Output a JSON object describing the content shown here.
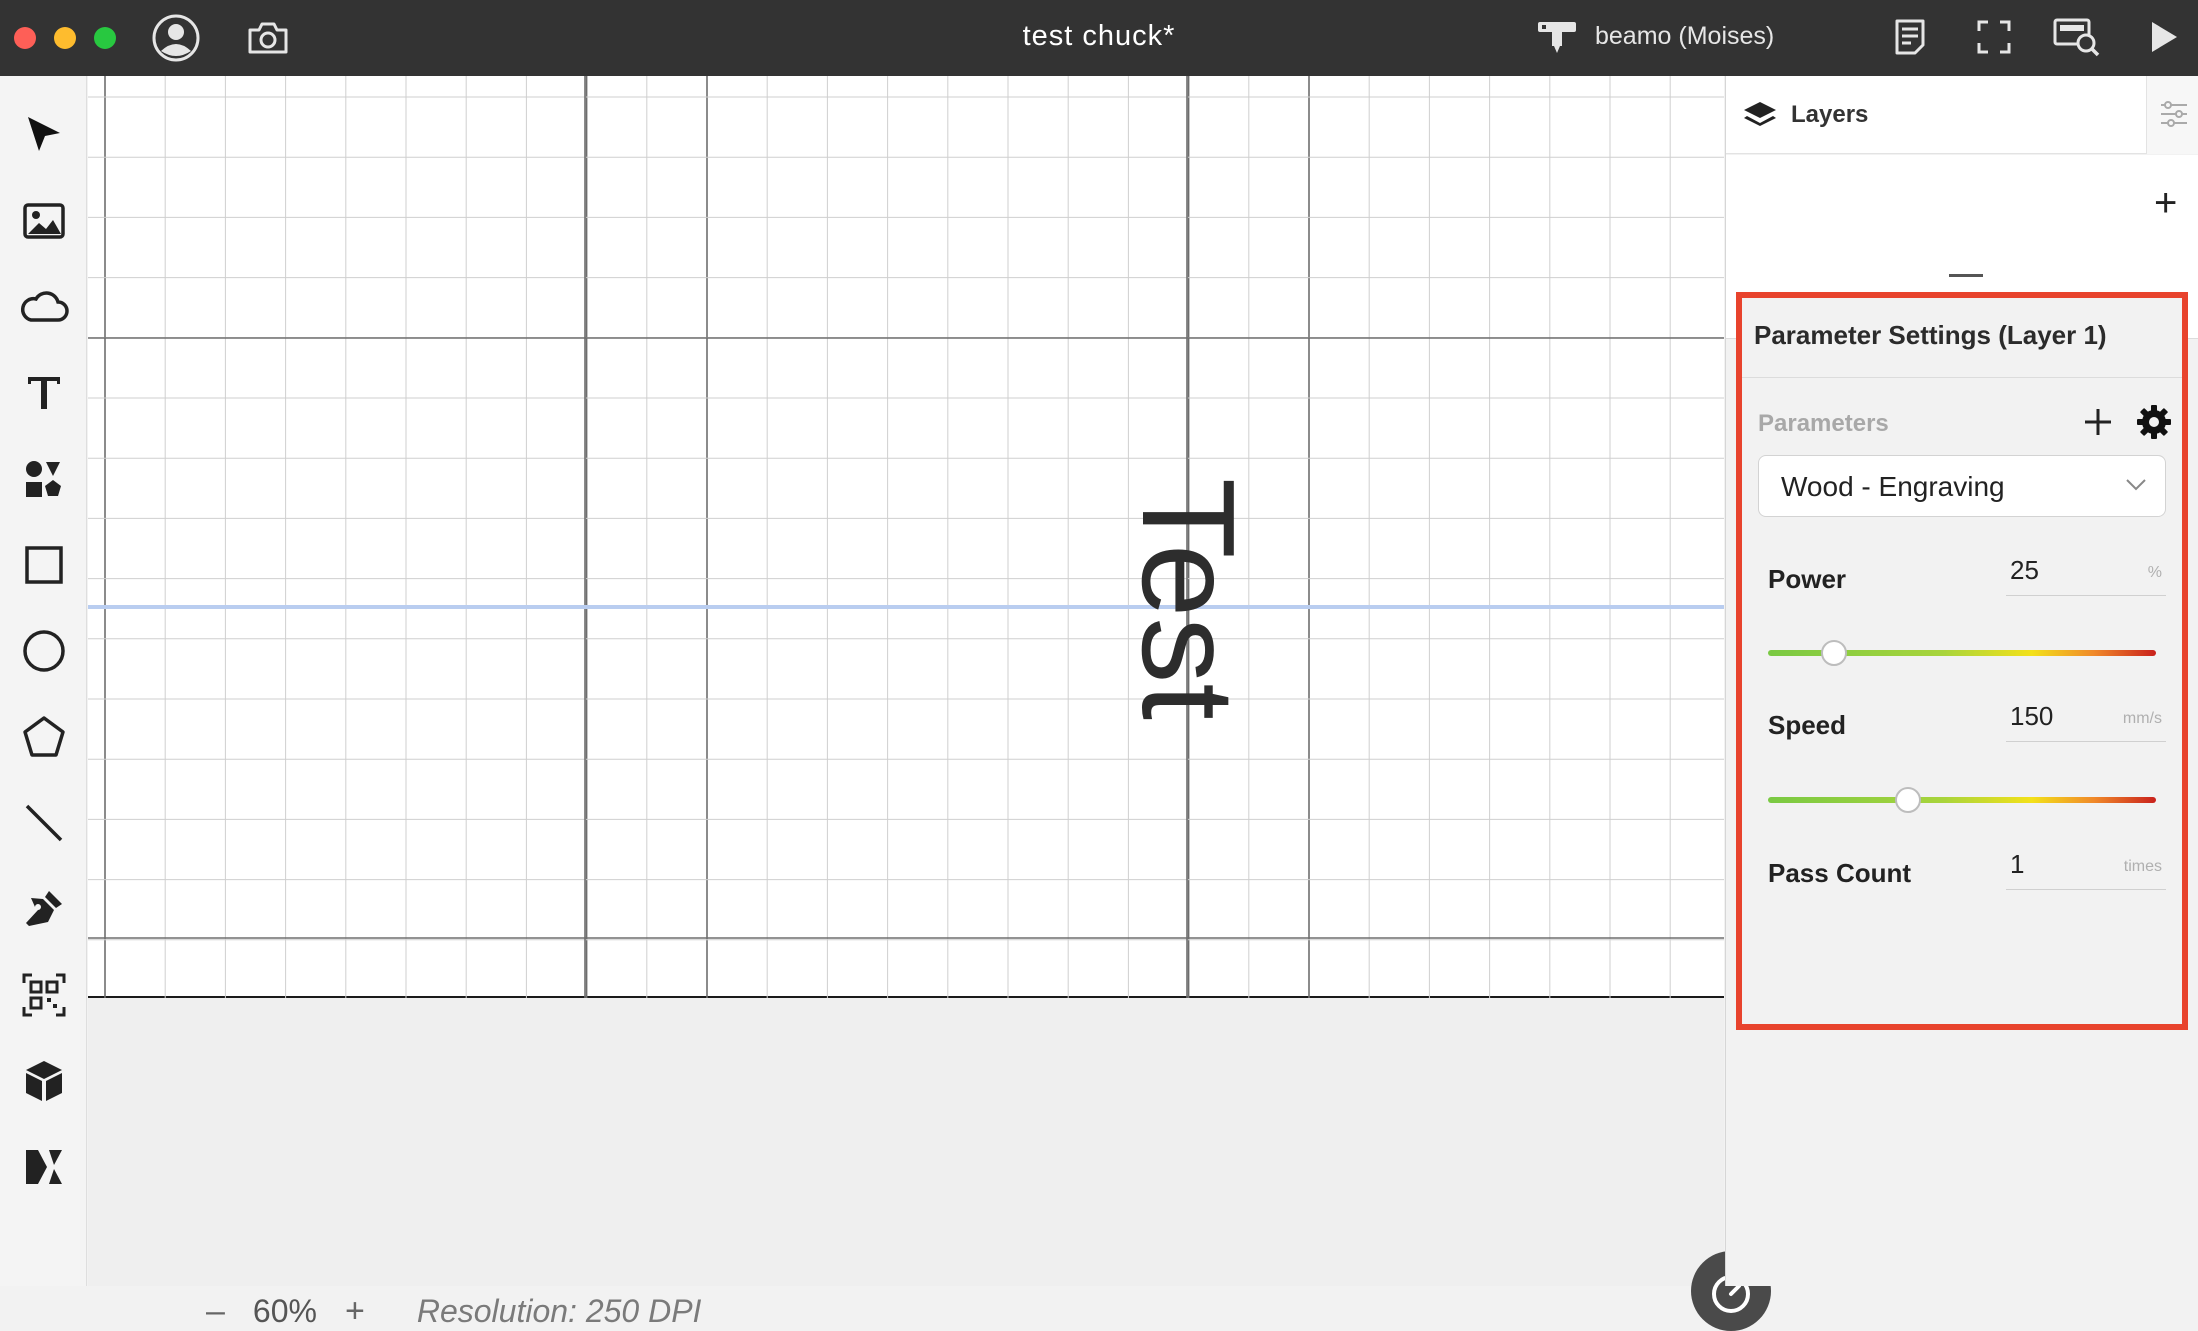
{
  "window": {
    "title": "test chuck*",
    "device_name": "beamo (Moises)"
  },
  "colors": {
    "titlebar": "#333333",
    "close": "#fe5f57",
    "minimize": "#febc2e",
    "maximize": "#28c840",
    "highlight_border": "#e8432d"
  },
  "left_toolbar": {
    "tools": [
      "cursor-icon",
      "image-icon",
      "cloud-icon",
      "text-icon",
      "elements-icon",
      "rectangle-icon",
      "ellipse-icon",
      "polygon-icon",
      "line-icon",
      "pen-icon",
      "qr-code-icon",
      "box-icon",
      "design-market-icon"
    ]
  },
  "canvas": {
    "text_object": "Test",
    "zoom": {
      "minus": "–",
      "value": "60%",
      "plus": "+"
    },
    "resolution": "Resolution: 250 DPI"
  },
  "layers_panel": {
    "title": "Layers",
    "add_label": "+"
  },
  "parameter_settings": {
    "title": "Parameter Settings (Layer 1)",
    "parameters_label": "Parameters",
    "preset": "Wood - Engraving",
    "power": {
      "label": "Power",
      "value": "25",
      "unit": "%",
      "slider_fraction": 0.17
    },
    "speed": {
      "label": "Speed",
      "value": "150",
      "unit": "mm/s",
      "slider_fraction": 0.36
    },
    "pass_count": {
      "label": "Pass Count",
      "value": "1",
      "unit": "times"
    }
  }
}
